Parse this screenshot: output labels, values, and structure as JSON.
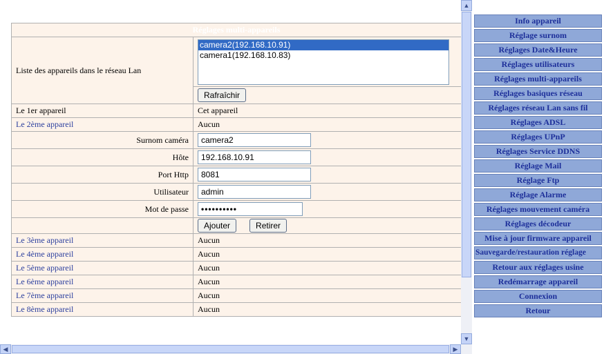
{
  "section_title": "Réglages multi-appareils",
  "device_list": {
    "label": "Liste des appareils dans le réseau Lan",
    "options": [
      "camera2(192.168.10.91)",
      "camera1(192.168.10.83)"
    ],
    "refresh_button": "Rafraîchir"
  },
  "first_device": {
    "label": "Le 1er appareil",
    "value": "Cet appareil"
  },
  "second_device": {
    "label": "Le 2ème appareil",
    "value": "Aucun",
    "alias_label": "Surnom caméra",
    "alias_value": "camera2",
    "host_label": "Hôte",
    "host_value": "192.168.10.91",
    "port_label": "Port Http",
    "port_value": "8081",
    "user_label": "Utilisateur",
    "user_value": "admin",
    "password_label": "Mot de passe",
    "password_value": "••••••••••",
    "add_button": "Ajouter",
    "remove_button": "Retirer"
  },
  "other_devices": [
    {
      "label": "Le 3ème appareil",
      "value": "Aucun"
    },
    {
      "label": "Le 4ème appareil",
      "value": "Aucun"
    },
    {
      "label": "Le 5ème appareil",
      "value": "Aucun"
    },
    {
      "label": "Le 6ème appareil",
      "value": "Aucun"
    },
    {
      "label": "Le 7ème appareil",
      "value": "Aucun"
    },
    {
      "label": "Le 8ème appareil",
      "value": "Aucun"
    }
  ],
  "menu": [
    "Info appareil",
    "Réglage surnom",
    "Réglages Date&Heure",
    "Réglages utilisateurs",
    "Réglages multi-appareils",
    "Réglages basiques réseau",
    "Réglages réseau Lan sans fil",
    "Réglages ADSL",
    "Réglages UPnP",
    "Réglages Service DDNS",
    "Réglage Mail",
    "Réglage Ftp",
    "Réglage Alarme",
    "Réglages mouvement caméra",
    "Réglages décodeur",
    "Mise à jour firmware appareil",
    "Sauvegarde/restauration réglage",
    "Retour aux réglages usine",
    "Redémarrage appareil",
    "Connexion",
    "Retour"
  ],
  "colors": {
    "header": "#3f83c2",
    "row_bg": "#fdf3ea",
    "menu_bg": "#8fa8d8",
    "menu_text": "#1d2f9a",
    "link": "#2b3f9e"
  },
  "icons": {
    "scroll_up": "arrow-up-icon",
    "scroll_down": "arrow-down-icon",
    "scroll_left": "arrow-left-icon",
    "scroll_right": "arrow-right-icon"
  }
}
